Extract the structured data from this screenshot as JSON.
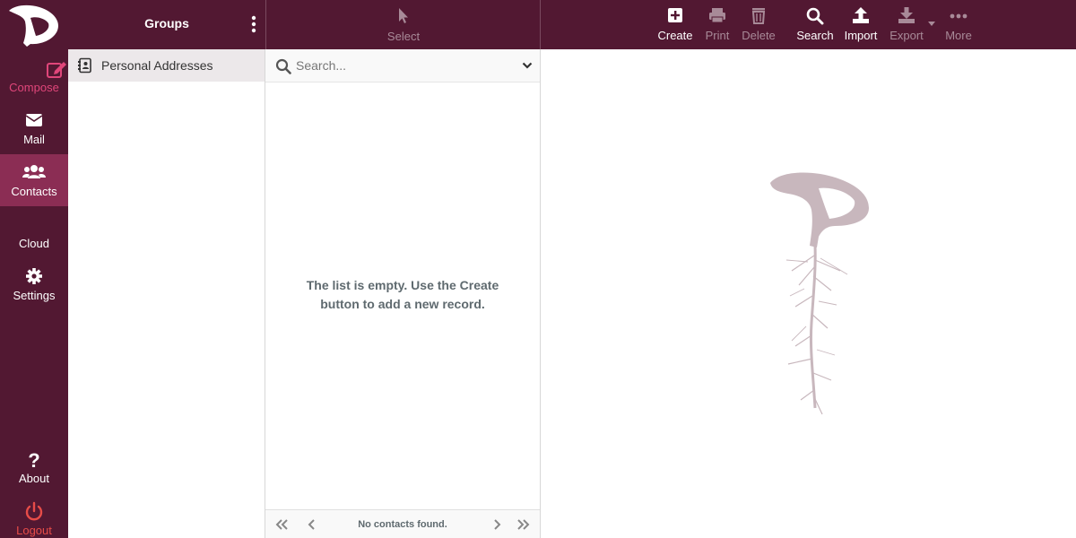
{
  "nav": {
    "compose": "Compose",
    "mail": "Mail",
    "contacts": "Contacts",
    "cloud": "Cloud",
    "settings": "Settings",
    "about": "About",
    "logout": "Logout"
  },
  "groups": {
    "title": "Groups",
    "items": [
      {
        "label": "Personal Addresses",
        "icon": "address-book-icon"
      }
    ]
  },
  "list": {
    "select_label": "Select",
    "search_placeholder": "Search...",
    "empty_message": "The list is empty. Use the Create button to add a new record.",
    "footer_text": "No contacts found."
  },
  "toolbar": {
    "create": "Create",
    "print": "Print",
    "delete": "Delete",
    "search": "Search",
    "import": "Import",
    "export": "Export",
    "more": "More"
  },
  "colors": {
    "header_bg": "#521832",
    "active_nav": "#8b2d54",
    "compose_accent": "#e0467a",
    "logout_accent": "#e74c48",
    "disabled_text": "#a88a98",
    "watermark": "#c8b7bd"
  }
}
